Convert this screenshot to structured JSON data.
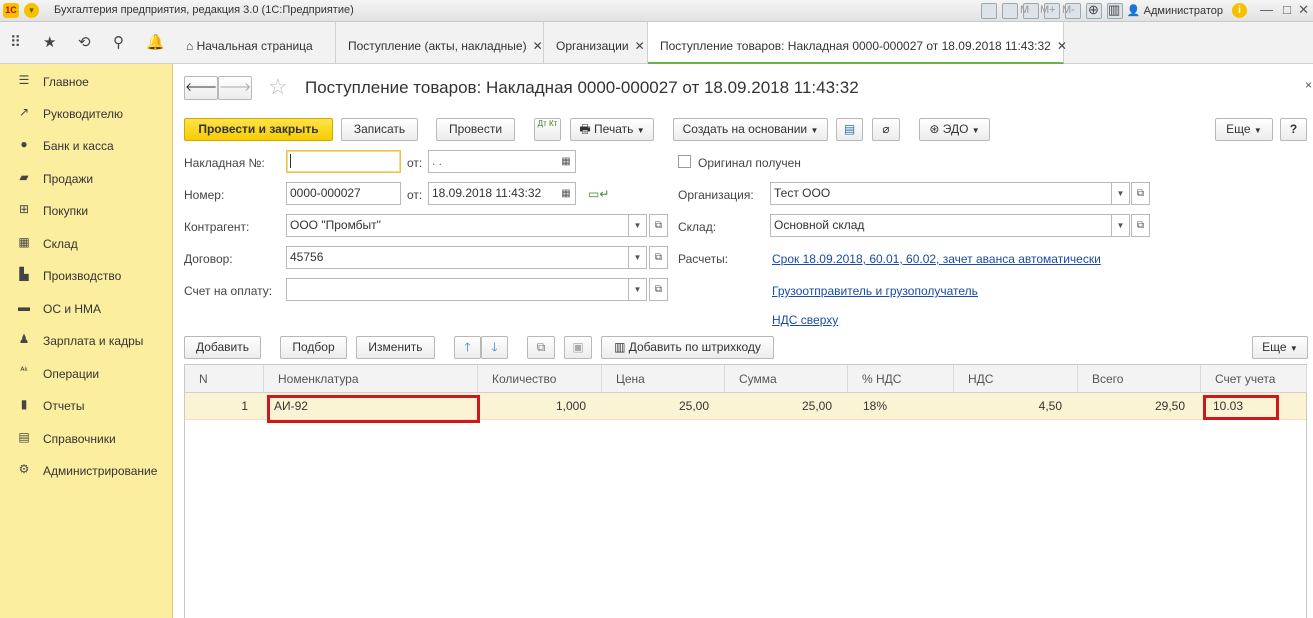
{
  "app": {
    "title": "Бухгалтерия предприятия, редакция 3.0 (1С:Предприятие)",
    "logo": "1С",
    "toolbar_m": "M",
    "toolbar_mplus": "M+",
    "toolbar_mminus": "M-",
    "user": "Администратор"
  },
  "tabs": [
    {
      "label": "Начальная страница"
    },
    {
      "label": "Поступление (акты, накладные)"
    },
    {
      "label": "Организации"
    },
    {
      "label": "Поступление товаров: Накладная 0000-000027 от 18.09.2018 11:43:32"
    }
  ],
  "sidebar": {
    "items": [
      {
        "label": "Главное",
        "icon": "menu-icon"
      },
      {
        "label": "Руководителю",
        "icon": "trend-icon"
      },
      {
        "label": "Банк и касса",
        "icon": "coin-icon"
      },
      {
        "label": "Продажи",
        "icon": "bag-icon"
      },
      {
        "label": "Покупки",
        "icon": "cart-icon"
      },
      {
        "label": "Склад",
        "icon": "warehouse-icon"
      },
      {
        "label": "Производство",
        "icon": "factory-icon"
      },
      {
        "label": "ОС и НМА",
        "icon": "truck-icon"
      },
      {
        "label": "Зарплата и кадры",
        "icon": "person-icon"
      },
      {
        "label": "Операции",
        "icon": "operations-icon"
      },
      {
        "label": "Отчеты",
        "icon": "bar-chart-icon"
      },
      {
        "label": "Справочники",
        "icon": "books-icon"
      },
      {
        "label": "Администрирование",
        "icon": "gear-icon"
      }
    ]
  },
  "document": {
    "title": "Поступление товаров: Накладная 0000-000027 от 18.09.2018 11:43:32"
  },
  "actions": {
    "post_close": "Провести и закрыть",
    "save": "Записать",
    "post": "Провести",
    "dt_kt": "Дт Кт",
    "print": "Печать",
    "create_based": "Создать на основании",
    "edo": "ЭДО",
    "more": "Еще",
    "help": "?"
  },
  "form": {
    "invoice_label": "Накладная №:",
    "invoice_value": "",
    "from_label": "от:",
    "invoice_date": " .  .",
    "original_label": "Оригинал получен",
    "number_label": "Номер:",
    "number_value": "0000-000027",
    "date_value": "18.09.2018 11:43:32",
    "org_label": "Организация:",
    "org_value": "Тест ООО",
    "counterparty_label": "Контрагент:",
    "counterparty_value": "ООО \"Промбыт\"",
    "warehouse_label": "Склад:",
    "warehouse_value": "Основной склад",
    "contract_label": "Договор:",
    "contract_value": "45756",
    "settlements_label": "Расчеты:",
    "settlements_link": "Срок 18.09.2018, 60.01, 60.02, зачет аванса автоматически",
    "payment_label": "Счет на оплату:",
    "payment_value": "",
    "shipper_link": "Грузоотправитель и грузополучатель",
    "vat_link": "НДС сверху"
  },
  "table_toolbar": {
    "add": "Добавить",
    "pick": "Подбор",
    "edit": "Изменить",
    "barcode": "Добавить по штрихкоду",
    "more": "Еще"
  },
  "table": {
    "columns": [
      "N",
      "Номенклатура",
      "Количество",
      "Цена",
      "Сумма",
      "% НДС",
      "НДС",
      "Всего",
      "Счет учета"
    ],
    "rows": [
      [
        "1",
        "АИ-92",
        "1,000",
        "25,00",
        "25,00",
        "18%",
        "4,50",
        "29,50",
        "10.03"
      ]
    ]
  }
}
